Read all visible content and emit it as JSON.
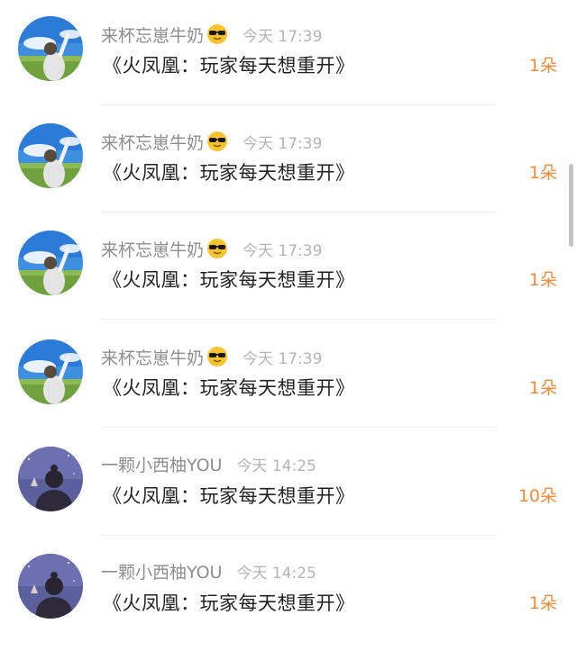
{
  "comments": [
    {
      "username": "来杯忘崽牛奶",
      "emoji": "sunglasses-emoji",
      "time": "今天 17:39",
      "title": "《火凤凰：玩家每天想重开》",
      "count": "1朵",
      "avatar": "sky-avatar"
    },
    {
      "username": "来杯忘崽牛奶",
      "emoji": "sunglasses-emoji",
      "time": "今天 17:39",
      "title": "《火凤凰：玩家每天想重开》",
      "count": "1朵",
      "avatar": "sky-avatar"
    },
    {
      "username": "来杯忘崽牛奶",
      "emoji": "sunglasses-emoji",
      "time": "今天 17:39",
      "title": "《火凤凰：玩家每天想重开》",
      "count": "1朵",
      "avatar": "sky-avatar"
    },
    {
      "username": "来杯忘崽牛奶",
      "emoji": "sunglasses-emoji",
      "time": "今天 17:39",
      "title": "《火凤凰：玩家每天想重开》",
      "count": "1朵",
      "avatar": "sky-avatar"
    },
    {
      "username": "一颗小西柚YOU",
      "emoji": "",
      "time": "今天 14:25",
      "title": "《火凤凰：玩家每天想重开》",
      "count": "10朵",
      "avatar": "night-avatar"
    },
    {
      "username": "一颗小西柚YOU",
      "emoji": "",
      "time": "今天 14:25",
      "title": "《火凤凰：玩家每天想重开》",
      "count": "1朵",
      "avatar": "night-avatar"
    }
  ],
  "colors": {
    "count_accent": "#f08a3c",
    "username": "#8e8e8e",
    "time": "#b5b5b5"
  }
}
